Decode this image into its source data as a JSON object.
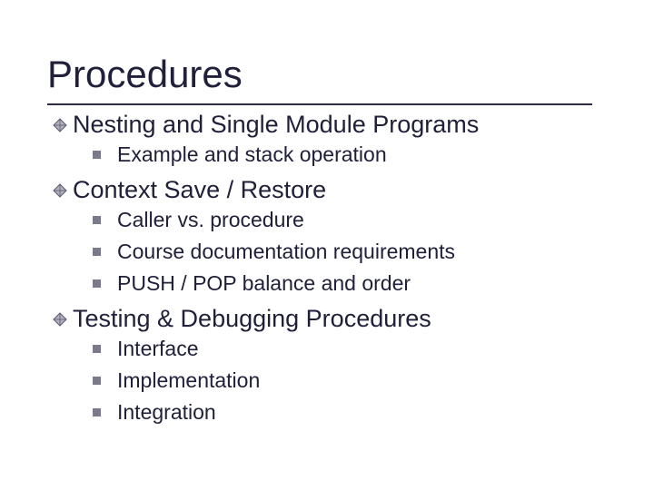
{
  "title": "Procedures",
  "sections": [
    {
      "heading": "Nesting and Single Module Programs",
      "items": [
        "Example and stack operation"
      ]
    },
    {
      "heading": "Context Save / Restore",
      "items": [
        "Caller vs. procedure",
        "Course documentation requirements",
        "PUSH / POP balance and order"
      ]
    },
    {
      "heading": "Testing & Debugging Procedures",
      "items": [
        "Interface",
        "Implementation",
        "Integration"
      ]
    }
  ],
  "colors": {
    "diamond_fill": "#b0b0c0",
    "diamond_stroke": "#5a5a70",
    "square": "#7a7a8a",
    "text": "#20203a"
  }
}
